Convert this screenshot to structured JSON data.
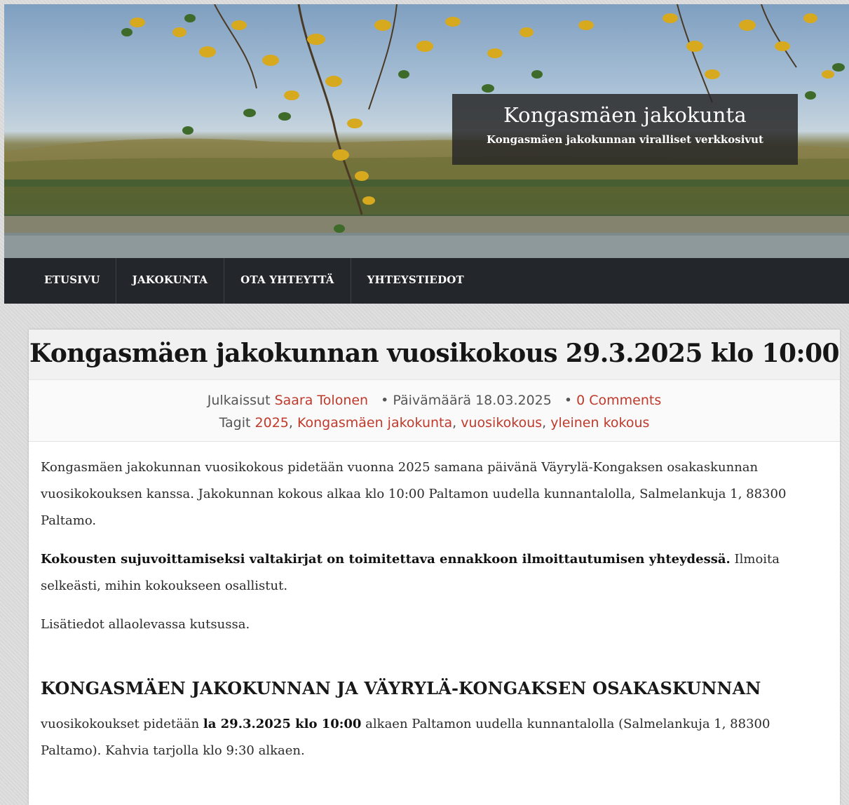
{
  "site": {
    "title": "Kongasmäen jakokunta",
    "tagline": "Kongasmäen jakokunnan viralliset verkkosivut"
  },
  "nav": {
    "items": [
      {
        "label": "ETUSIVU"
      },
      {
        "label": "JAKOKUNTA"
      },
      {
        "label": "OTA YHTEYTTÄ"
      },
      {
        "label": "YHTEYSTIEDOT"
      }
    ]
  },
  "post": {
    "title": "Kongasmäen jakokunnan vuosikokous 29.3.2025 klo 10:00",
    "meta": {
      "published_label": "Julkaissut",
      "author": "Saara Tolonen",
      "date_label": "Päivämäärä 18.03.2025",
      "comments": "0 Comments",
      "tags_label": "Tagit",
      "tags": [
        "2025",
        "Kongasmäen jakokunta",
        "vuosikokous",
        "yleinen kokous"
      ]
    },
    "paragraph1": "Kongasmäen jakokunnan vuosikokous pidetään vuonna 2025 samana päivänä Väyrylä-Kongaksen osakaskunnan vuosikokouksen kanssa. Jakokunnan kokous alkaa klo 10:00 Paltamon uudella kunnantalolla, Salmelankuja 1, 88300 Paltamo.",
    "paragraph2_bold": "Kokousten sujuvoittamiseksi valtakirjat on toimitettava ennakkoon ilmoittautumisen yhteydessä.",
    "paragraph2_rest": " Ilmoita selkeästi, mihin kokoukseen osallistut.",
    "paragraph3": "Lisätiedot allaolevassa kutsussa.",
    "section_heading": "KONGASMÄEN JAKOKUNNAN JA VÄYRYLÄ-KONGAKSEN OSAKASKUNNAN",
    "paragraph4_pre": "vuosikokoukset pidetään ",
    "paragraph4_bold": "la 29.3.2025 klo 10:00",
    "paragraph4_post": " alkaen Paltamon uudella kunnantalolla (Salmelankuja 1, 88300 Paltamo). Kahvia tarjolla klo 9:30 alkaen."
  }
}
